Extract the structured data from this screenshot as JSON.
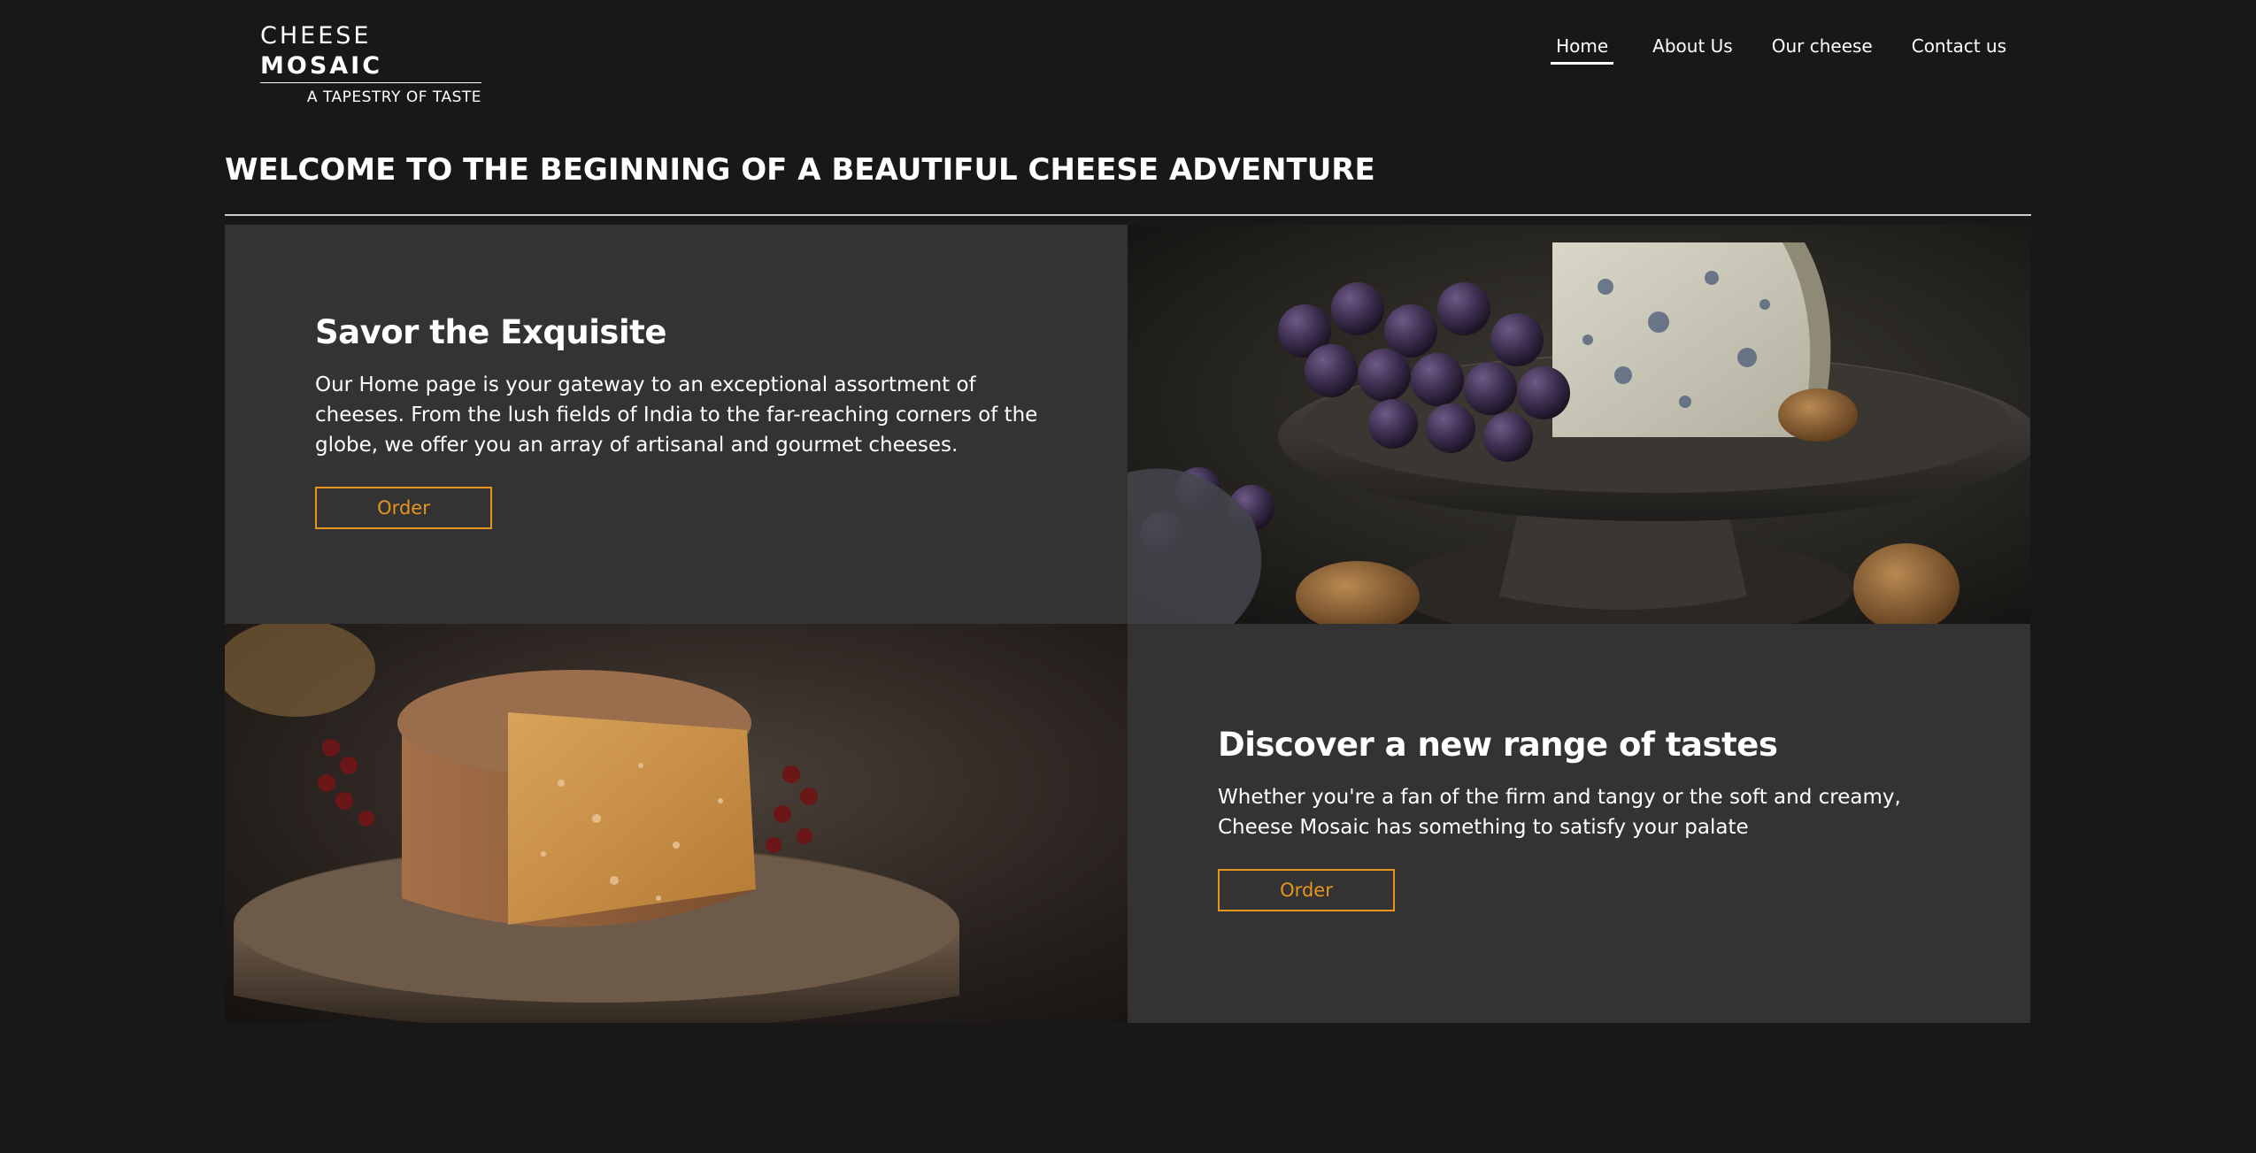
{
  "header": {
    "logo_word1": "CHEESE",
    "logo_word2": "MOSAIC",
    "logo_tagline": "A TAPESTRY OF TASTE",
    "nav": [
      {
        "label": "Home",
        "active": true
      },
      {
        "label": "About Us",
        "active": false
      },
      {
        "label": "Our cheese",
        "active": false
      },
      {
        "label": "Contact us",
        "active": false
      }
    ]
  },
  "welcome_title": "WELCOME TO THE BEGINNING OF A BEAUTIFUL CHEESE ADVENTURE",
  "sections": [
    {
      "title": "Savor the Exquisite",
      "body": "Our Home page is your gateway to an exceptional assortment of cheeses. From the lush fields of India to the far-reaching corners of the globe, we offer you an array of artisanal and gourmet cheeses.",
      "button": "Order"
    },
    {
      "title": "Discover a new range of tastes",
      "body": "Whether you're a fan of the firm and tangy or the soft and creamy, Cheese Mosaic has something to satisfy your palate",
      "button": "Order"
    }
  ],
  "images": [
    {
      "icon": "blue-cheese-grapes-photo"
    },
    {
      "icon": "aged-cheese-wheel-photo"
    }
  ],
  "colors": {
    "background": "#181818",
    "panel": "#333333",
    "accent": "#e8951d",
    "text": "#ffffff"
  }
}
